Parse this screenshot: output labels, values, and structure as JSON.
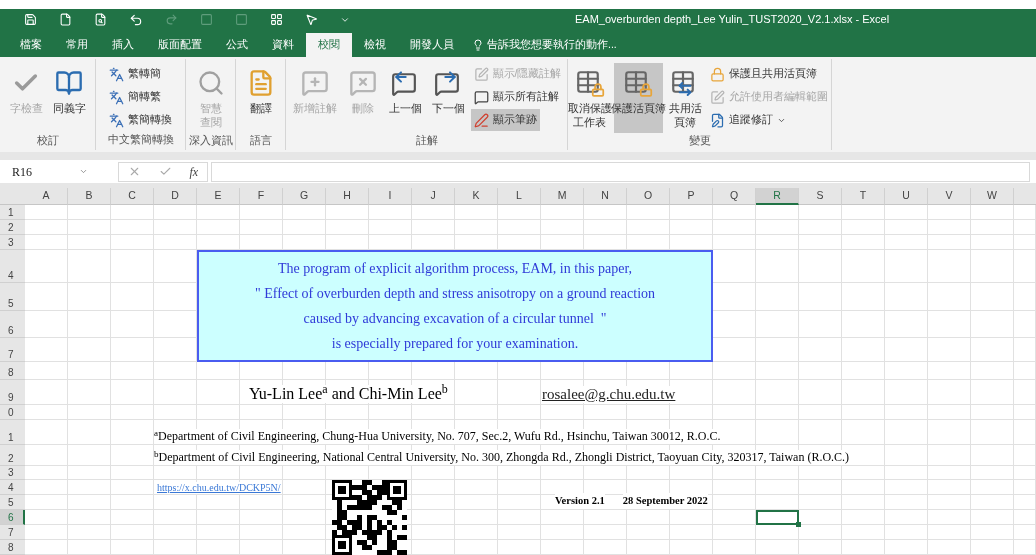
{
  "window": {
    "title": "EAM_overburden depth_Lee Yulin_TUST2020_V2.1.xlsx - Excel"
  },
  "ribbon_tabs": [
    {
      "label": "檔案",
      "selected": false
    },
    {
      "label": "常用",
      "selected": false
    },
    {
      "label": "插入",
      "selected": false
    },
    {
      "label": "版面配置",
      "selected": false
    },
    {
      "label": "公式",
      "selected": false
    },
    {
      "label": "資料",
      "selected": false
    },
    {
      "label": "校閱",
      "selected": true
    },
    {
      "label": "檢視",
      "selected": false
    },
    {
      "label": "開發人員",
      "selected": false
    }
  ],
  "tell_me": {
    "placeholder": "告訴我您想要執行的動作..."
  },
  "ribbon_groups": [
    {
      "label": "校訂",
      "buttons": [
        {
          "kind": "large",
          "label": "字檢查",
          "disabled": true,
          "on": false
        },
        {
          "kind": "large",
          "label": "同義字",
          "disabled": false,
          "on": false
        }
      ]
    },
    {
      "label": "中文繁簡轉換",
      "buttons": [
        {
          "kind": "small",
          "label": "繁轉簡",
          "disabled": false,
          "on": false
        },
        {
          "kind": "small",
          "label": "簡轉繁",
          "disabled": false,
          "on": false
        },
        {
          "kind": "small",
          "label": "繁簡轉換",
          "disabled": false,
          "on": false
        }
      ]
    },
    {
      "label": "深入資訊",
      "buttons": [
        {
          "kind": "large",
          "label": "智慧查閱",
          "disabled": true,
          "on": false
        }
      ]
    },
    {
      "label": "語言",
      "buttons": [
        {
          "kind": "large",
          "label": "翻譯",
          "disabled": false,
          "on": false
        }
      ]
    },
    {
      "label": "註解",
      "buttons": [
        {
          "kind": "large",
          "label": "新增註解",
          "disabled": true,
          "on": false
        },
        {
          "kind": "large",
          "label": "刪除",
          "disabled": true,
          "on": false
        },
        {
          "kind": "large",
          "label": "上一個",
          "disabled": false,
          "on": false
        },
        {
          "kind": "large",
          "label": "下一個",
          "disabled": false,
          "on": false
        },
        {
          "kind": "small",
          "label": "顯示/隱藏註解",
          "disabled": true,
          "on": false
        },
        {
          "kind": "small",
          "label": "顯示所有註解",
          "disabled": false,
          "on": false
        },
        {
          "kind": "small",
          "label": "顯示筆跡",
          "disabled": false,
          "on": true
        }
      ]
    },
    {
      "label": "變更",
      "buttons": [
        {
          "kind": "large",
          "label": "取消保護工作表",
          "disabled": false,
          "on": false
        },
        {
          "kind": "large",
          "label": "保護活頁簿",
          "disabled": false,
          "on": true
        },
        {
          "kind": "large",
          "label": "共用活頁簿",
          "disabled": false,
          "on": false
        },
        {
          "kind": "small",
          "label": "保護且共用活頁簿",
          "disabled": false,
          "on": false
        },
        {
          "kind": "small",
          "label": "允許使用者編輯範圍",
          "disabled": true,
          "on": false
        },
        {
          "kind": "small",
          "label": "追蹤修訂",
          "disabled": false,
          "on": false
        }
      ]
    }
  ],
  "formula_bar": {
    "name_box": "R16",
    "function_label": "fx"
  },
  "columns": [
    {
      "label": "A",
      "selected": false
    },
    {
      "label": "B",
      "selected": false
    },
    {
      "label": "C",
      "selected": false
    },
    {
      "label": "D",
      "selected": false
    },
    {
      "label": "E",
      "selected": false
    },
    {
      "label": "F",
      "selected": false
    },
    {
      "label": "G",
      "selected": false
    },
    {
      "label": "H",
      "selected": false
    },
    {
      "label": "I",
      "selected": false
    },
    {
      "label": "J",
      "selected": false
    },
    {
      "label": "K",
      "selected": false
    },
    {
      "label": "L",
      "selected": false
    },
    {
      "label": "M",
      "selected": false
    },
    {
      "label": "N",
      "selected": false
    },
    {
      "label": "O",
      "selected": false
    },
    {
      "label": "P",
      "selected": false
    },
    {
      "label": "Q",
      "selected": false
    },
    {
      "label": "R",
      "selected": true
    },
    {
      "label": "S",
      "selected": false
    },
    {
      "label": "T",
      "selected": false
    },
    {
      "label": "U",
      "selected": false
    },
    {
      "label": "V",
      "selected": false
    },
    {
      "label": "W",
      "selected": false
    }
  ],
  "rows": [
    {
      "label": "1",
      "selected": false
    },
    {
      "label": "2",
      "selected": false
    },
    {
      "label": "3",
      "selected": false
    },
    {
      "label": "4",
      "selected": false
    },
    {
      "label": "5",
      "selected": false
    },
    {
      "label": "6",
      "selected": false
    },
    {
      "label": "7",
      "selected": false
    },
    {
      "label": "8",
      "selected": false
    },
    {
      "label": "9",
      "selected": false
    },
    {
      "label": "0",
      "selected": false
    },
    {
      "label": "1",
      "selected": false
    },
    {
      "label": "2",
      "selected": false
    },
    {
      "label": "3",
      "selected": false
    },
    {
      "label": "4",
      "selected": false
    },
    {
      "label": "5",
      "selected": false
    },
    {
      "label": "6",
      "selected": true
    },
    {
      "label": "7",
      "selected": false
    },
    {
      "label": "8",
      "selected": false
    }
  ],
  "sheet": {
    "notice_lines": [
      "The program of explicit algorithm process, EAM, in this paper,",
      "\" Effect of overburden depth and stress anisotropy on a ground reaction",
      "caused by advancing excavation of a circular tunnel  \"",
      "is especially prepared for your examination."
    ],
    "authors": "Yu-Lin Lee$^{a}$ and Chi-Min Lee$^{b}$",
    "email": "rosalee@g.chu.edu.tw",
    "affiliations": [
      "$^{a}$Department of Civil Engineering, Chung-Hua University, No. 707, Sec.2, Wufu Rd., Hsinchu, Taiwan 30012, R.O.C.",
      "$^{b}$Department of Civil Engineering, National Central University, No. 300, Zhongda Rd., Zhongli District, Taoyuan City, 320317, Taiwan (R.O.C.)"
    ],
    "link": "https://x.chu.edu.tw/DCKP5N/",
    "version": "Version 2.1",
    "date": "28 September 2022"
  }
}
